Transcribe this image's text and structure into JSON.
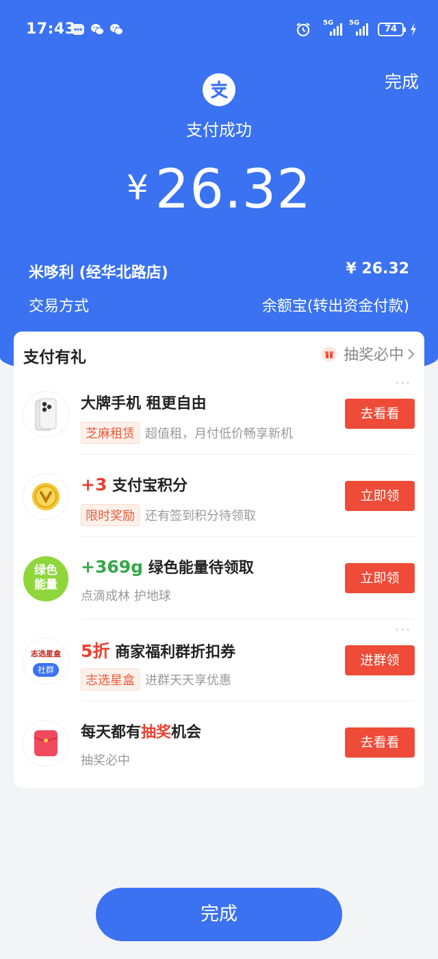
{
  "status_bar": {
    "time": "17:43",
    "signal_label_1": "5G",
    "signal_label_2": "5G",
    "battery": "74"
  },
  "header": {
    "done_label": "完成",
    "status": "支付成功",
    "currency": "¥",
    "amount": "26.32",
    "merchant_label": "米哆利 (经华北路店)",
    "merchant_amount": "¥ 26.32",
    "method_label": "交易方式",
    "method_value": "余额宝(转出资金付款)"
  },
  "rewards": {
    "title": "支付有礼",
    "link_label": "抽奖必中",
    "items": [
      {
        "highlight": "",
        "title": "大牌手机 租更自由",
        "tag": "芝麻租赁",
        "subtitle": "超值租，月付低价畅享新机",
        "button": "去看看"
      },
      {
        "highlight": "+3",
        "title": "支付宝积分",
        "tag": "限时奖励",
        "subtitle": "还有签到积分待领取",
        "button": "立即领"
      },
      {
        "highlight": "+369g",
        "title": "绿色能量待领取",
        "tag": "",
        "subtitle": "点滴成林 护地球",
        "button": "立即领",
        "thumb_text_1": "绿色",
        "thumb_text_2": "能量"
      },
      {
        "highlight": "5折",
        "title": "商家福利群折扣券",
        "tag": "志选星盒",
        "subtitle": "进群天天享优惠",
        "button": "进群领",
        "thumb_text_1": "志选星盒",
        "thumb_text_2": "社群"
      },
      {
        "title_part_1": "每天都有",
        "title_part_2": "抽奖",
        "title_part_3": "机会",
        "subtitle": "抽奖必中",
        "button": "去看看"
      }
    ]
  },
  "footer": {
    "done_label": "完成"
  },
  "colors": {
    "brand_blue": "#3a72f2",
    "action_red": "#ee4b38",
    "highlight_green": "#35a64b"
  }
}
